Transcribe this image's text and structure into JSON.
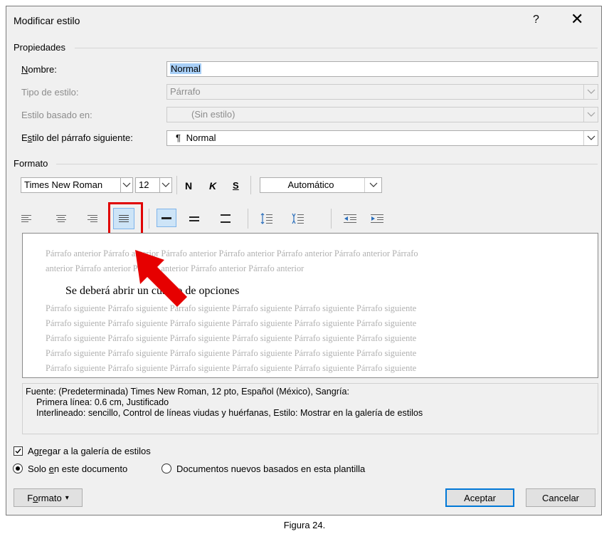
{
  "dialog": {
    "title": "Modificar estilo",
    "help": "?",
    "close": "✕"
  },
  "properties": {
    "group_label": "Propiedades",
    "name_label_u": "N",
    "name_label_rest": "ombre:",
    "name_value": "Normal",
    "style_type_label": "Tipo de estilo:",
    "style_type_value": "Párrafo",
    "based_on_label": "Estilo basado en:",
    "based_on_value": "(Sin estilo)",
    "next_style_label_a": "E",
    "next_style_label_u": "s",
    "next_style_label_rest": "tilo del párrafo siguiente:",
    "next_style_icon": "¶",
    "next_style_value": "Normal"
  },
  "format": {
    "group_label": "Formato",
    "font_name": "Times New Roman",
    "font_size": "12",
    "bold": "N",
    "italic": "K",
    "underline": "S",
    "color": "Automático"
  },
  "preview": {
    "prev_line1": "Párrafo anterior Párrafo anterior Párrafo anterior Párrafo anterior Párrafo anterior Párrafo anterior Párrafo",
    "prev_line2": "anterior Párrafo anterior Párrafo anterior Párrafo anterior Párrafo anterior",
    "main_text": "Se deberá abrir un cuadro de opciones",
    "next_line": "Párrafo siguiente Párrafo siguiente Párrafo siguiente Párrafo siguiente Párrafo siguiente Párrafo siguiente"
  },
  "description": {
    "line1": "Fuente: (Predeterminada) Times New Roman, 12 pto, Español (México), Sangría:",
    "line2": "Primera línea:  0.6 cm, Justificado",
    "line3": "Interlineado:  sencillo, Control de líneas viudas y huérfanas, Estilo: Mostrar en la galería de estilos"
  },
  "options": {
    "add_gallery_a": "Ag",
    "add_gallery_u": "r",
    "add_gallery_rest": "egar a la galería de estilos",
    "only_doc_a": "Solo ",
    "only_doc_u": "e",
    "only_doc_rest": "n este documento",
    "new_docs": "Documentos nuevos basados en esta plantilla"
  },
  "buttons": {
    "format_a": "F",
    "format_u": "o",
    "format_rest": "rmato",
    "format_arrow": "▾",
    "ok": "Aceptar",
    "cancel": "Cancelar"
  },
  "caption": "Figura 24.",
  "colors": {
    "highlight_box": "#e00000",
    "arrow": "#e60000",
    "primary_border": "#0078d7",
    "selection": "#a8cff7"
  }
}
